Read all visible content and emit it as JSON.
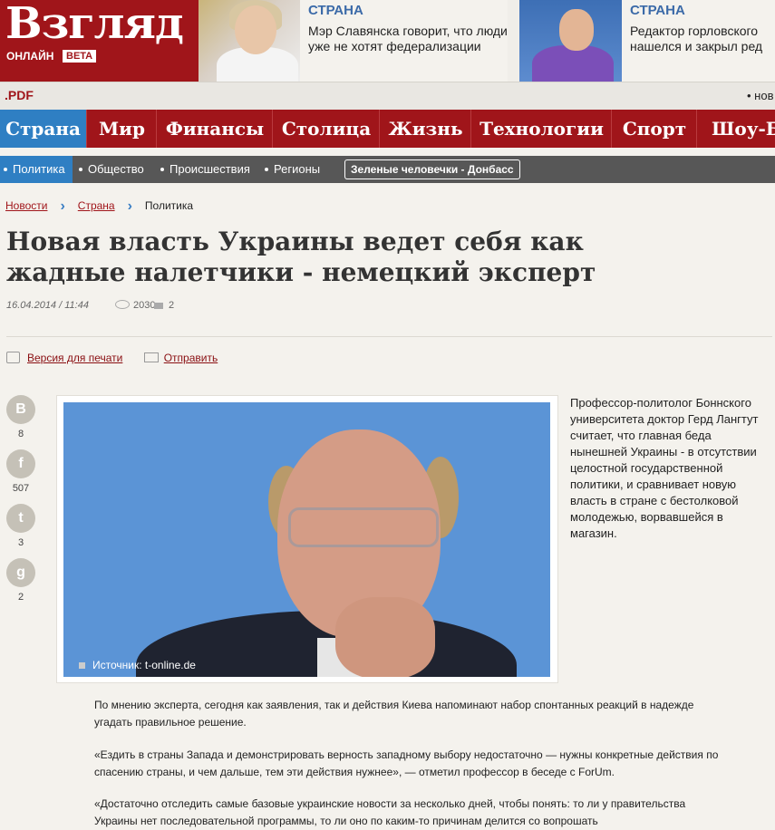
{
  "logo": {
    "title": "Взгляд",
    "online": "ОНЛАЙН",
    "beta": "BETA"
  },
  "news": [
    {
      "category": "СТРАНА",
      "text": "Мэр Славянска говорит, что люди уже не хотят федерализации"
    },
    {
      "category": "СТРАНА",
      "text": "Редактор горловского нашелся и закрыл ред"
    }
  ],
  "toolbar": {
    "pdf": ".PDF",
    "right": "• нов"
  },
  "mainnav": [
    "Страна",
    "Мир",
    "Финансы",
    "Столица",
    "Жизнь",
    "Технологии",
    "Спорт",
    "Шоу-Би"
  ],
  "subnav": [
    "Политика",
    "Общество",
    "Происшествия",
    "Регионы"
  ],
  "tag": "Зеленые человечки - Донбасс",
  "breadcrumb": [
    "Новости",
    "Страна",
    "Политика"
  ],
  "article": {
    "title": "Новая власть Украины ведет себя как жадные налетчики - немецкий эксперт",
    "date": "16.04.2014 / 11:44",
    "views": "2030",
    "comments": "2",
    "print": "Версия для печати",
    "send": "Отправить",
    "caption": "Источник: t-online.de",
    "lead": "Профессор-политолог Боннского университета доктор Герд Лангтут считает, что главная беда нынешней Украины - в отсутствии целостной государственной политики, и сравнивает новую власть в стране с бестолковой молодежью, ворвавшейся в магазин.",
    "paragraphs": [
      "По мнению эксперта, сегодня как заявления, так и действия Киева напоминают набор спонтанных реакций в надежде угадать правильное решение.",
      "«Ездить в страны Запада и демонстрировать верность западному выбору недостаточно — нужны конкретные действия по спасению страны, и чем дальше, тем эти действия нужнее», — отметил профессор в беседе с ForUm.",
      "«Достаточно отследить самые базовые украинские новости за несколько дней, чтобы понять: то ли у правительства Украины нет последовательной программы, то ли оно по каким-то причинам делится со вопрошать"
    ]
  },
  "share": [
    {
      "icon": "В",
      "count": "8"
    },
    {
      "icon": "f",
      "count": "507"
    },
    {
      "icon": "t",
      "count": "3"
    },
    {
      "icon": "g",
      "count": "2"
    }
  ]
}
